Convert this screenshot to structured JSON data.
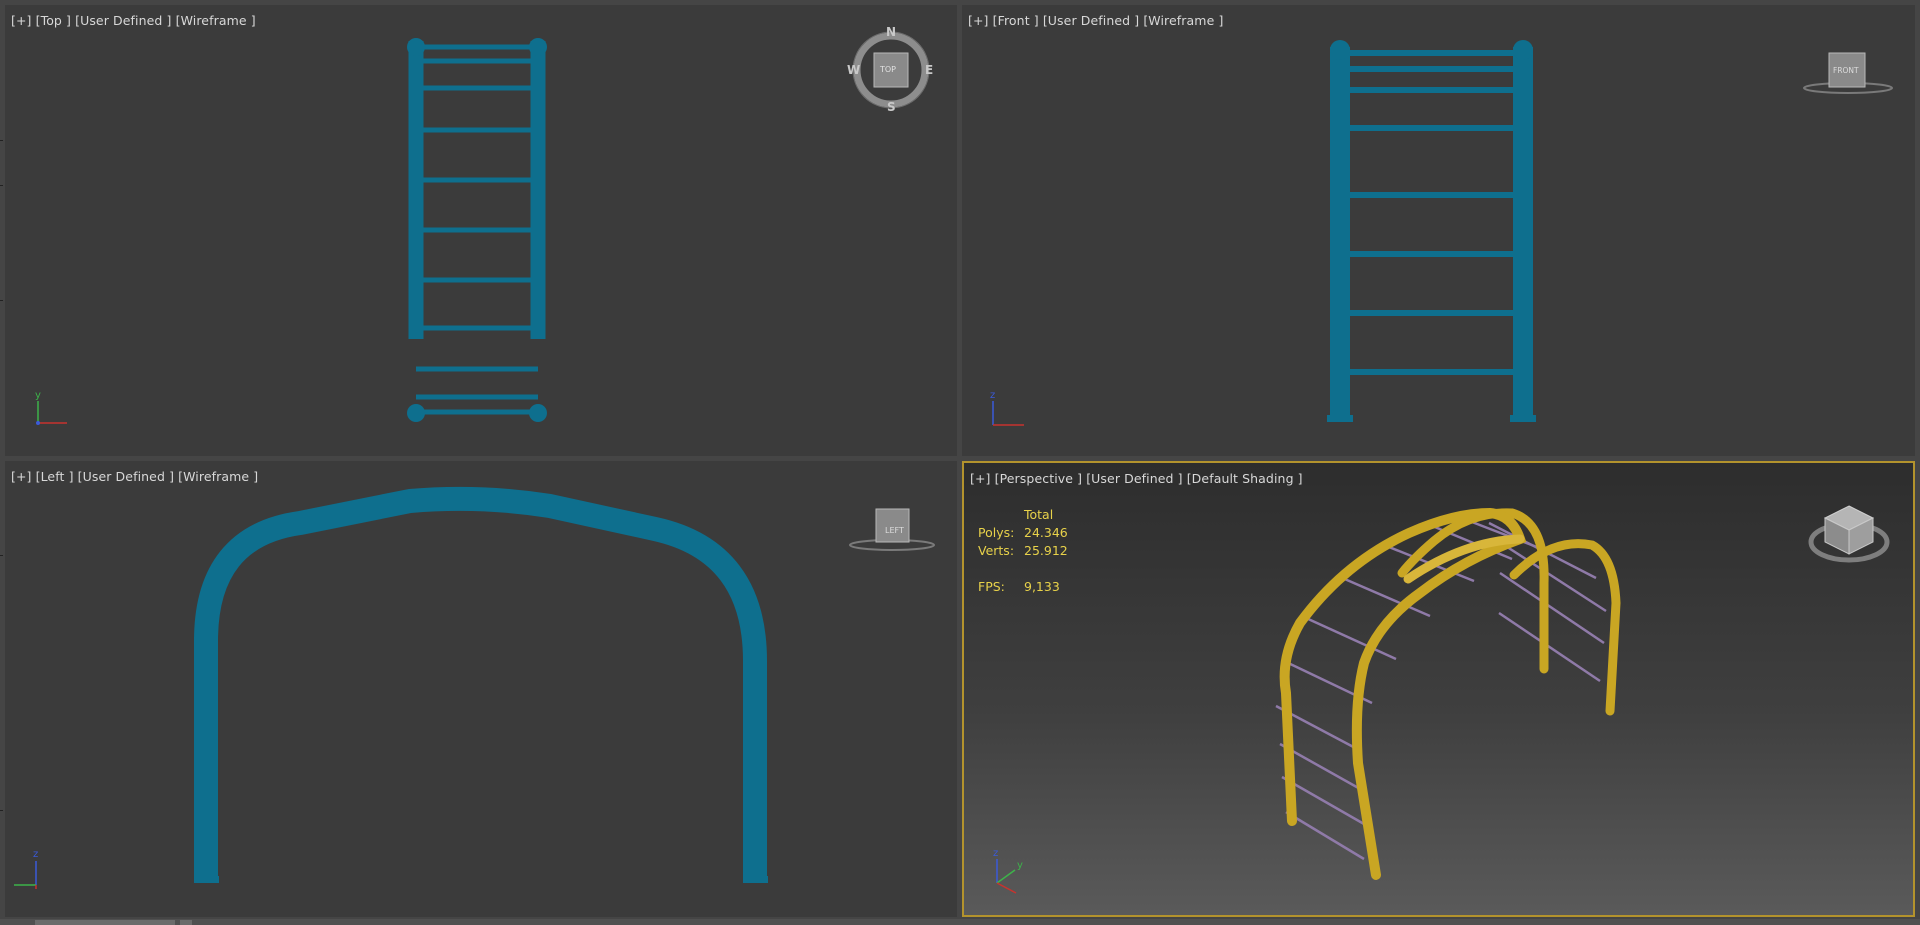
{
  "viewports": {
    "top": {
      "label": "[+] [Top ] [User Defined ] [Wireframe ]",
      "cube": {
        "face": "TOP",
        "n": "N",
        "s": "S",
        "e": "E",
        "w": "W"
      },
      "axis": {
        "v": "y",
        "h": "x"
      }
    },
    "front": {
      "label": "[+] [Front ] [User Defined ] [Wireframe ]",
      "cube": {
        "face": "FRONT"
      },
      "axis": {
        "v": "z",
        "h": "x"
      }
    },
    "left": {
      "label": "[+] [Left ] [User Defined ] [Wireframe ]",
      "cube": {
        "face": "LEFT"
      },
      "axis": {
        "v": "z",
        "h": "y"
      }
    },
    "perspective": {
      "label": "[+] [Perspective ] [User Defined ] [Default Shading ]",
      "stats": {
        "header": "Total",
        "polys_label": "Polys:",
        "polys_value": "24.346",
        "verts_label": "Verts:",
        "verts_value": "25.912",
        "fps_label": "FPS:",
        "fps_value": "9,133"
      },
      "axis": {
        "z": "z",
        "y": "y",
        "x": "x"
      }
    }
  },
  "colors": {
    "wire": "#0e6f8e",
    "pipe": "#c9a623",
    "rung": "#8f7aa8",
    "active_border": "#b3932d",
    "stats_text": "#e8d24a"
  }
}
